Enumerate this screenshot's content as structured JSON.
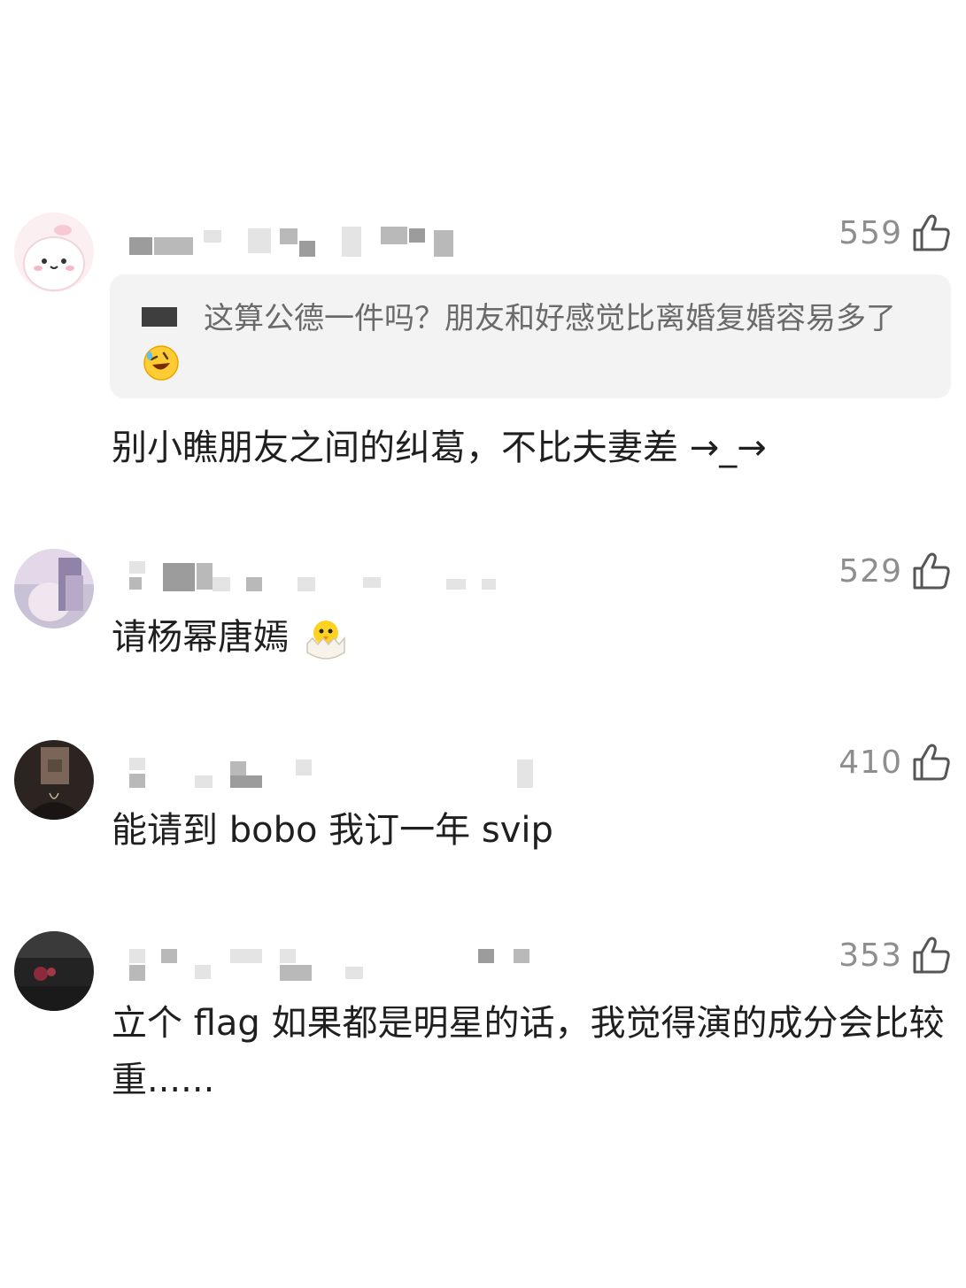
{
  "comments": [
    {
      "likes": "559",
      "quote": {
        "text": "这算公德一件吗？朋友和好感觉比离婚复婚容易多了"
      },
      "text": "别小瞧朋友之间的纠葛，不比夫妻差 →_→"
    },
    {
      "likes": "529",
      "text": "请杨幂唐嫣"
    },
    {
      "likes": "410",
      "text": "能请到 bobo 我订一年 svip"
    },
    {
      "likes": "353",
      "text": "立个 flag 如果都是明星的话，我觉得演的成分会比较重......"
    }
  ],
  "icons": {
    "like": "thumbs-up-icon",
    "emoji_laugh": "rolling-laughing-emoji",
    "emoji_chick": "hatching-chick-emoji"
  },
  "colors": {
    "like_count": "#8e8e8e",
    "quote_bg": "#f3f3f3",
    "quote_text": "#6a6a6a",
    "body_text": "#1f1f1f"
  }
}
